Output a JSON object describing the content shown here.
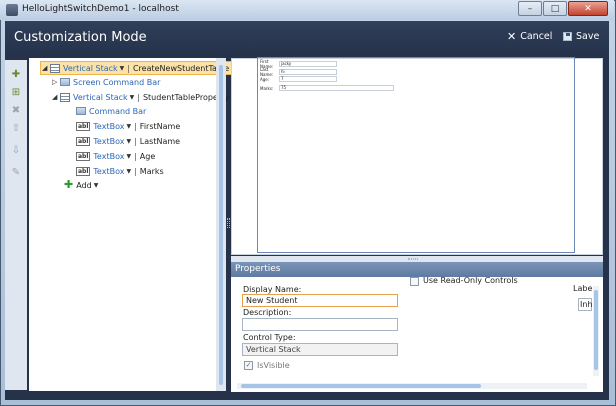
{
  "window": {
    "title": "HelloLightSwitchDemo1 - localhost",
    "minimize_glyph": "–",
    "maximize_glyph": "□",
    "close_glyph": "✕"
  },
  "header": {
    "title": "Customization Mode",
    "cancel_label": "Cancel",
    "save_label": "Save"
  },
  "toolbar": {
    "items": [
      "add-item-icon",
      "add-group-icon",
      "delete-icon",
      "move-up-icon",
      "move-down-icon",
      "edit-icon"
    ]
  },
  "tree": {
    "root": {
      "control": "Vertical Stack",
      "name": "CreateNewStudentTable"
    },
    "screen_command_bar": "Screen Command Bar",
    "child_stack": {
      "control": "Vertical Stack",
      "name": "StudentTableProperty"
    },
    "command_bar": "Command Bar",
    "fields": [
      {
        "control": "TextBox",
        "name": "FirstName"
      },
      {
        "control": "TextBox",
        "name": "LastName"
      },
      {
        "control": "TextBox",
        "name": "Age"
      },
      {
        "control": "TextBox",
        "name": "Marks"
      }
    ],
    "add_label": "Add"
  },
  "preview": {
    "rows": [
      {
        "label": "First Name:",
        "value": "jacky"
      },
      {
        "label": "Last Name:",
        "value": "hi"
      },
      {
        "label": "Age:",
        "value": "7"
      },
      {
        "label": "Marks:",
        "value": "75"
      }
    ]
  },
  "properties": {
    "title": "Properties",
    "read_only_label": "Use Read-Only Controls",
    "display_name_label": "Display Name:",
    "display_name_value": "New Student",
    "description_label": "Description:",
    "description_value": "",
    "control_type_label": "Control Type:",
    "control_type_value": "Vertical Stack",
    "is_visible_label": "IsVisible",
    "is_visible_checked": true,
    "label_partial": "Labe",
    "inh_partial": "Inh"
  }
}
